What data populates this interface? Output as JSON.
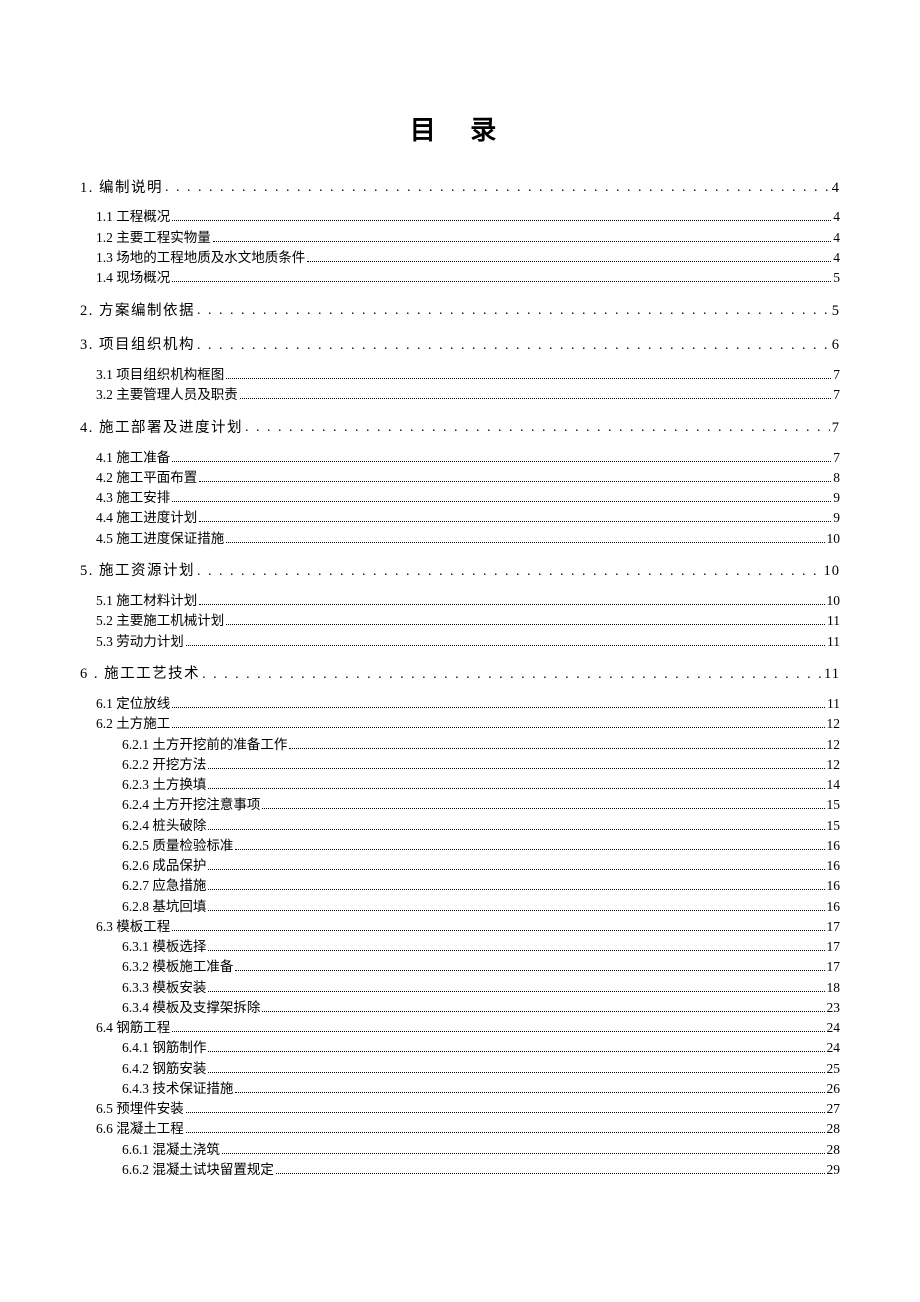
{
  "title": "目 录",
  "toc": [
    {
      "level": 1,
      "label": "1. 编制说明",
      "page": "4"
    },
    {
      "level": 2,
      "label": "1.1 工程概况",
      "page": "4"
    },
    {
      "level": 2,
      "label": "1.2 主要工程实物量",
      "page": "4"
    },
    {
      "level": 2,
      "label": "1.3 场地的工程地质及水文地质条件",
      "page": "4"
    },
    {
      "level": 2,
      "label": "1.4 现场概况",
      "page": "5"
    },
    {
      "level": 1,
      "label": "2. 方案编制依据",
      "page": "5"
    },
    {
      "level": 1,
      "label": "3. 项目组织机构",
      "page": "6"
    },
    {
      "level": 2,
      "label": "3.1 项目组织机构框图",
      "page": "7"
    },
    {
      "level": 2,
      "label": "3.2 主要管理人员及职责",
      "page": "7"
    },
    {
      "level": 1,
      "label": "4. 施工部署及进度计划",
      "page": "7"
    },
    {
      "level": 2,
      "label": "4.1 施工准备",
      "page": "7"
    },
    {
      "level": 2,
      "label": "4.2 施工平面布置",
      "page": "8"
    },
    {
      "level": 2,
      "label": "4.3 施工安排",
      "page": "9"
    },
    {
      "level": 2,
      "label": "4.4 施工进度计划",
      "page": "9"
    },
    {
      "level": 2,
      "label": "4.5 施工进度保证措施",
      "page": "10"
    },
    {
      "level": 1,
      "label": "5. 施工资源计划",
      "page": "10"
    },
    {
      "level": 2,
      "label": "5.1 施工材料计划",
      "page": "10"
    },
    {
      "level": 2,
      "label": "5.2 主要施工机械计划",
      "page": "11"
    },
    {
      "level": 2,
      "label": "5.3 劳动力计划",
      "page": "11"
    },
    {
      "level": 1,
      "label": "6 . 施工工艺技术",
      "page": "11"
    },
    {
      "level": 2,
      "label": "6.1 定位放线",
      "page": "11"
    },
    {
      "level": 2,
      "label": "6.2 土方施工",
      "page": "12"
    },
    {
      "level": 3,
      "label": "6.2.1 土方开挖前的准备工作",
      "page": "12"
    },
    {
      "level": 3,
      "label": "6.2.2 开挖方法",
      "page": "12"
    },
    {
      "level": 3,
      "label": "6.2.3 土方换填",
      "page": "14"
    },
    {
      "level": 3,
      "label": "6.2.4 土方开挖注意事项",
      "page": "15"
    },
    {
      "level": 3,
      "label": "6.2.4 桩头破除",
      "page": "15"
    },
    {
      "level": 3,
      "label": "6.2.5 质量检验标准",
      "page": "16"
    },
    {
      "level": 3,
      "label": "6.2.6 成品保护",
      "page": "16"
    },
    {
      "level": 3,
      "label": "6.2.7 应急措施",
      "page": "16"
    },
    {
      "level": 3,
      "label": "6.2.8 基坑回填",
      "page": "16"
    },
    {
      "level": 2,
      "label": "6.3 模板工程",
      "page": "17"
    },
    {
      "level": 3,
      "label": "6.3.1 模板选择",
      "page": "17"
    },
    {
      "level": 3,
      "label": "6.3.2 模板施工准备",
      "page": "17"
    },
    {
      "level": 3,
      "label": "6.3.3 模板安装",
      "page": "18"
    },
    {
      "level": 3,
      "label": "6.3.4 模板及支撑架拆除",
      "page": "23"
    },
    {
      "level": 2,
      "label": "6.4 钢筋工程",
      "page": "24"
    },
    {
      "level": 3,
      "label": "6.4.1 钢筋制作",
      "page": "24"
    },
    {
      "level": 3,
      "label": "6.4.2 钢筋安装",
      "page": "25"
    },
    {
      "level": 3,
      "label": "6.4.3 技术保证措施",
      "page": "26"
    },
    {
      "level": 2,
      "label": "6.5 预埋件安装",
      "page": "27"
    },
    {
      "level": 2,
      "label": "6.6 混凝土工程",
      "page": "28"
    },
    {
      "level": 3,
      "label": "6.6.1 混凝土浇筑",
      "page": "28"
    },
    {
      "level": 3,
      "label": "6.6.2 混凝土试块留置规定",
      "page": "29"
    }
  ]
}
